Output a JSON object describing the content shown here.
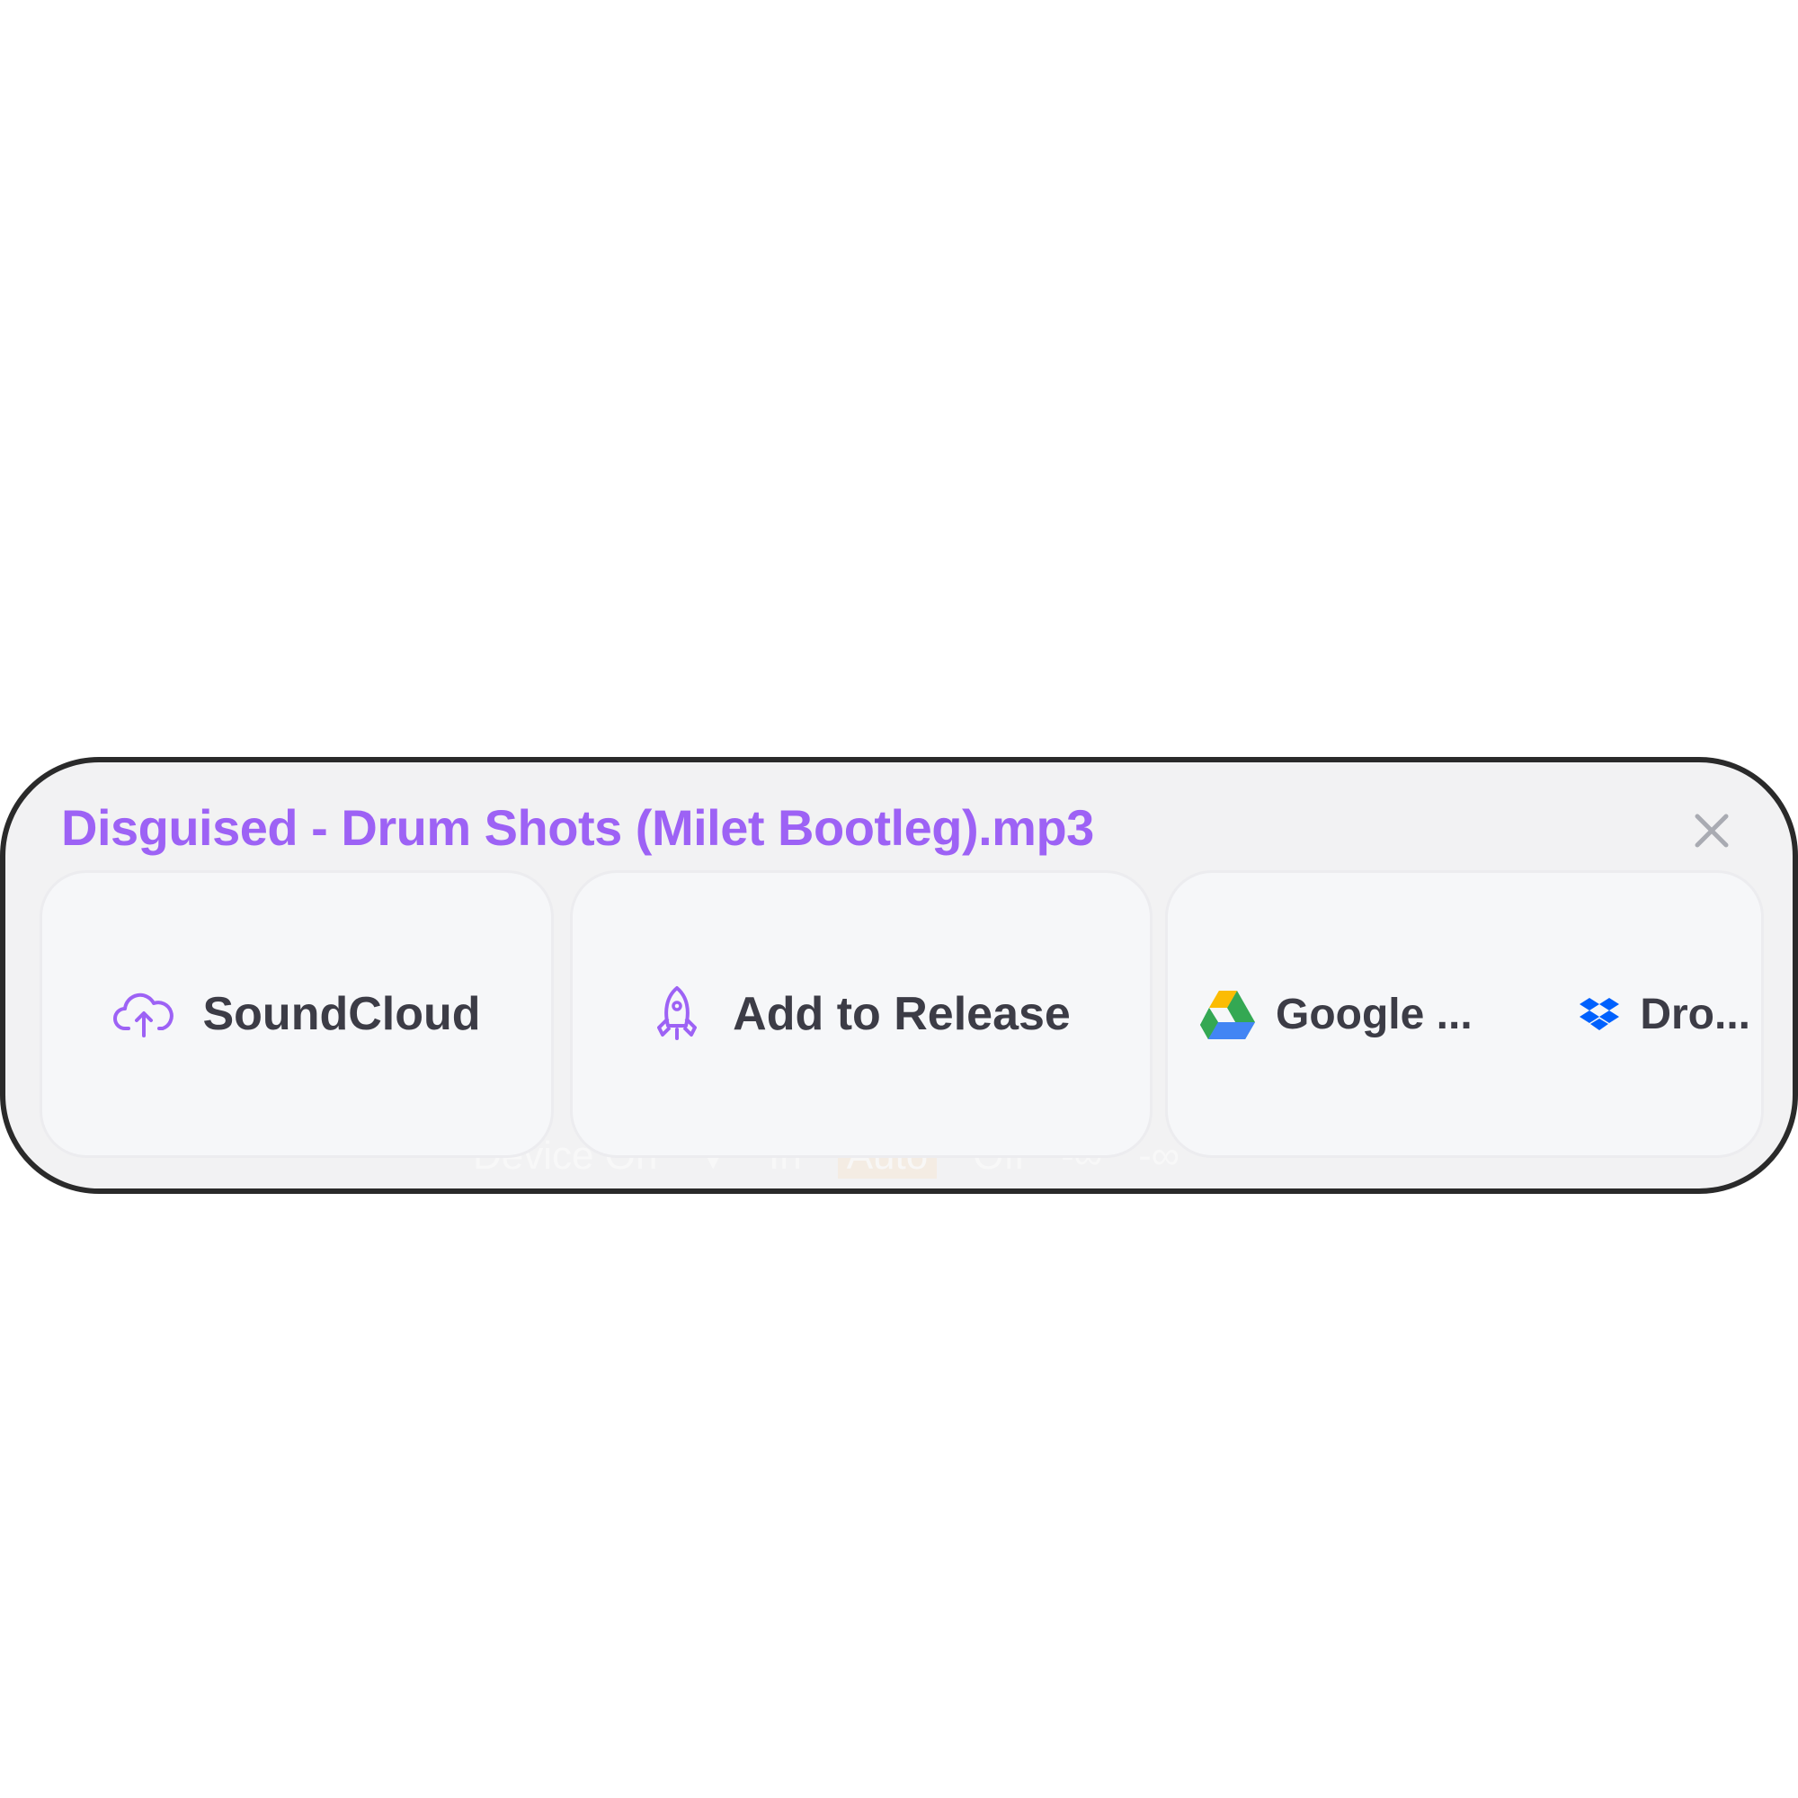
{
  "dialog": {
    "file_title": "Disguised - Drum Shots (Milet Bootleg).mp3",
    "close_icon": "close-icon",
    "accent_color": "#9d62f5"
  },
  "destinations": [
    {
      "label": "SoundCloud",
      "icon": "cloud-upload-icon"
    },
    {
      "label": "Add to Release",
      "icon": "rocket-icon"
    },
    {
      "label": "Google ...",
      "icon": "google-drive-icon"
    },
    {
      "label": "Dro...",
      "icon": "dropbox-icon"
    }
  ],
  "background_strip": {
    "device": "Device On",
    "input": "In",
    "auto": "Auto",
    "off": "Off",
    "level_1": "-∞",
    "level_2": "-∞"
  }
}
